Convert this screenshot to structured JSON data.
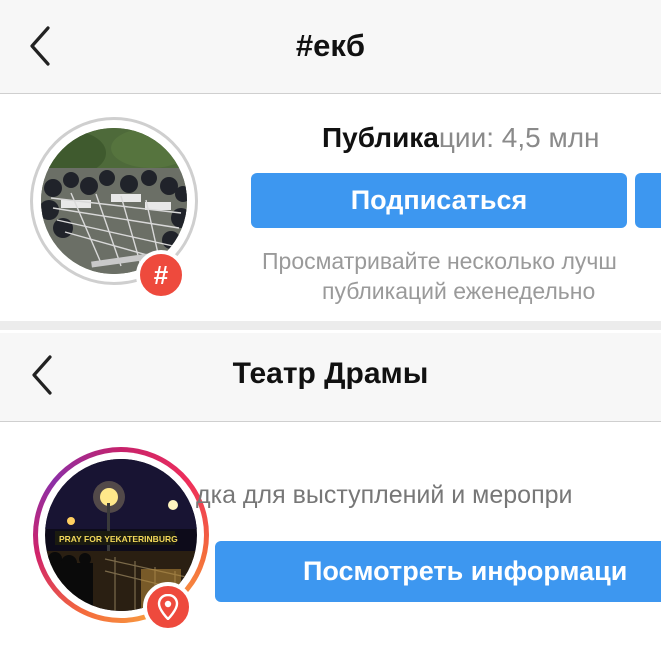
{
  "hashtag_page": {
    "title": "#екб",
    "stats_bold": "Публика",
    "stats_rest": "ции: 4,5 млн",
    "follow_button": "Подписаться",
    "description_line1": "Просматривайте несколько лучш",
    "description_line2": "публикаций еженедельно",
    "badge_symbol": "#"
  },
  "location_page": {
    "title": "Театр Драмы",
    "category": "дка для выступлений и меропри",
    "info_button": "Посмотреть информаци",
    "photo_caption": "PRAY FOR YEKATERINBURG"
  },
  "colors": {
    "accent_blue": "#3d97f0",
    "badge_red": "#ee4a3d",
    "header_bg": "#f7f7f7"
  },
  "icons": {
    "back": "chevron-left-icon",
    "hashtag": "hashtag-icon",
    "location": "location-pin-icon"
  }
}
